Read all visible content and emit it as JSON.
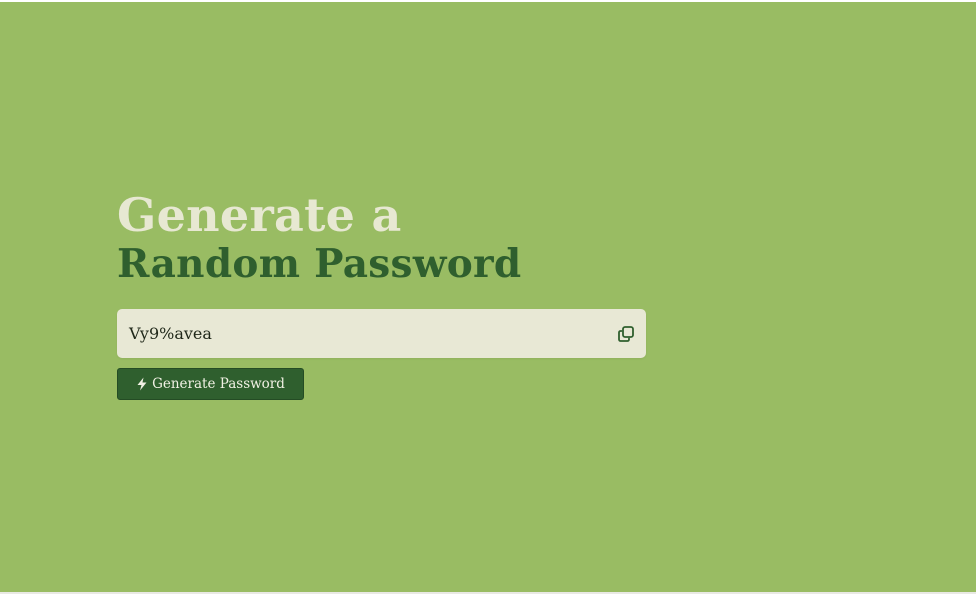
{
  "heading": {
    "line1": "Generate a",
    "line2": "Random Password"
  },
  "password": {
    "value": "Vy9%avea",
    "copy_icon": "copy-icon"
  },
  "generate_button": {
    "label": "Generate Password",
    "icon": "lightning-bolt-icon"
  },
  "colors": {
    "background": "#99bc63",
    "accent_dark_green": "#2f5f2e",
    "heading_light": "#e7e8d2",
    "field_background": "#e8e8d5"
  }
}
